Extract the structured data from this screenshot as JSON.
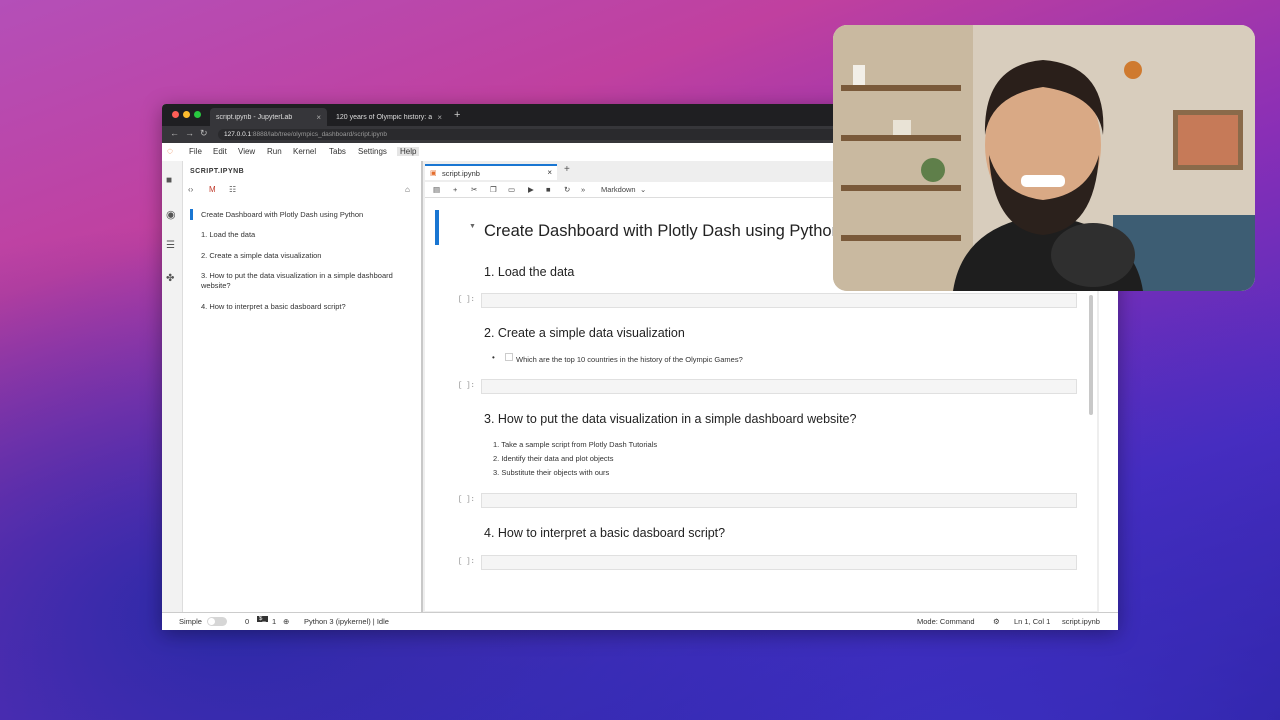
{
  "browser": {
    "tabs": [
      {
        "title": "script.ipynb - JupyterLab",
        "close": "×"
      },
      {
        "title": "120 years of Olympic history: a",
        "close": "×"
      }
    ],
    "new_tab": "+",
    "url_host": "127.0.0.1",
    "url_rest": ":8888/lab/tree/olympics_dashboard/script.ipynb",
    "nav": {
      "back": "←",
      "forward": "→",
      "reload": "↻"
    }
  },
  "menubar": {
    "items": [
      "File",
      "Edit",
      "View",
      "Run",
      "Kernel",
      "Tabs",
      "Settings",
      "Help"
    ]
  },
  "toc": {
    "header": "SCRIPT.IPYNB",
    "items": [
      "Create Dashboard with Plotly Dash using Python",
      "1. Load the data",
      "2. Create a simple data visualization",
      "3. How to put the data visualization in a simple dashboard website?",
      "4. How to interpret a basic dasboard script?"
    ]
  },
  "notebook": {
    "tab_title": "script.ipynb",
    "tab_close": "×",
    "add_tab": "+",
    "cell_type": "Markdown",
    "title": "Create Dashboard with Plotly Dash using Python",
    "prompt": "[ ]:",
    "sections": [
      {
        "heading": "1. Load the data"
      },
      {
        "heading": "2. Create a simple data visualization",
        "bullet": "Which are the top 10 countries in the history of the Olympic Games?"
      },
      {
        "heading": "3. How to put the data visualization in a simple dashboard website?",
        "list": [
          "1. Take a sample script from Plotly Dash Tutorials",
          "2. Identify their data and plot objects",
          "3. Substitute their objects with ours"
        ]
      },
      {
        "heading": "4. How to interpret a basic dasboard script?"
      }
    ]
  },
  "status": {
    "mode_label": "Simple",
    "count1": "0",
    "count2": "1",
    "kernel": "Python 3 (ipykernel) | Idle",
    "mode": "Mode: Command",
    "position": "Ln 1, Col 1",
    "file": "script.ipynb"
  }
}
